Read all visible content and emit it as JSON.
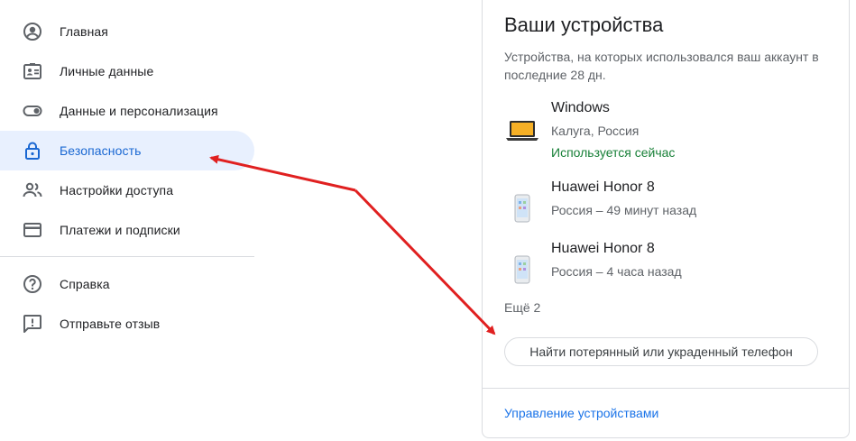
{
  "sidebar": {
    "items": [
      {
        "label": "Главная",
        "icon": "account-circle-icon"
      },
      {
        "label": "Личные данные",
        "icon": "id-card-icon"
      },
      {
        "label": "Данные и персонализация",
        "icon": "toggle-icon"
      },
      {
        "label": "Безопасность",
        "icon": "lock-icon",
        "active": true
      },
      {
        "label": "Настройки доступа",
        "icon": "people-icon"
      },
      {
        "label": "Платежи и подписки",
        "icon": "credit-card-icon"
      }
    ],
    "secondary": [
      {
        "label": "Справка",
        "icon": "help-icon"
      },
      {
        "label": "Отправьте отзыв",
        "icon": "feedback-icon"
      }
    ]
  },
  "devices_card": {
    "title": "Ваши устройства",
    "description": "Устройства, на которых использовался ваш аккаунт в последние 28 дн.",
    "devices": [
      {
        "name": "Windows",
        "meta": "Калуга, Россия",
        "status": "Используется сейчас",
        "icon": "laptop-icon"
      },
      {
        "name": "Huawei Honor 8",
        "meta": "Россия – 49 минут назад",
        "icon": "phone-icon"
      },
      {
        "name": "Huawei Honor 8",
        "meta": "Россия – 4 часа назад",
        "icon": "phone-icon"
      }
    ],
    "more_label": "Ещё 2",
    "find_button": "Найти потерянный или украденный телефон",
    "manage_link": "Управление устройствами"
  },
  "colors": {
    "accent": "#1967d2",
    "active_bg": "#e8f0fe",
    "status_green": "#188038",
    "annotation_arrow": "#e02020"
  }
}
